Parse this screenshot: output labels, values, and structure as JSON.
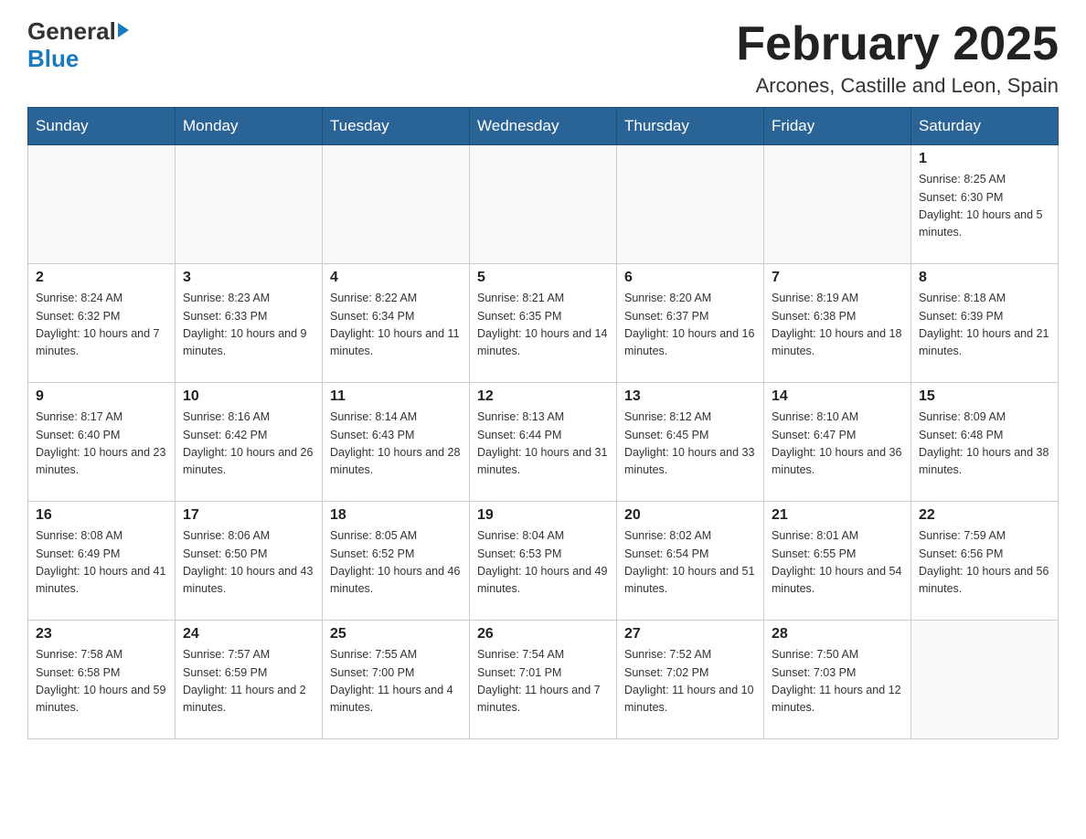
{
  "header": {
    "logo_general": "General",
    "logo_blue": "Blue",
    "month_title": "February 2025",
    "location": "Arcones, Castille and Leon, Spain"
  },
  "weekdays": [
    "Sunday",
    "Monday",
    "Tuesday",
    "Wednesday",
    "Thursday",
    "Friday",
    "Saturday"
  ],
  "weeks": [
    [
      {
        "day": "",
        "sunrise": "",
        "sunset": "",
        "daylight": ""
      },
      {
        "day": "",
        "sunrise": "",
        "sunset": "",
        "daylight": ""
      },
      {
        "day": "",
        "sunrise": "",
        "sunset": "",
        "daylight": ""
      },
      {
        "day": "",
        "sunrise": "",
        "sunset": "",
        "daylight": ""
      },
      {
        "day": "",
        "sunrise": "",
        "sunset": "",
        "daylight": ""
      },
      {
        "day": "",
        "sunrise": "",
        "sunset": "",
        "daylight": ""
      },
      {
        "day": "1",
        "sunrise": "Sunrise: 8:25 AM",
        "sunset": "Sunset: 6:30 PM",
        "daylight": "Daylight: 10 hours and 5 minutes."
      }
    ],
    [
      {
        "day": "2",
        "sunrise": "Sunrise: 8:24 AM",
        "sunset": "Sunset: 6:32 PM",
        "daylight": "Daylight: 10 hours and 7 minutes."
      },
      {
        "day": "3",
        "sunrise": "Sunrise: 8:23 AM",
        "sunset": "Sunset: 6:33 PM",
        "daylight": "Daylight: 10 hours and 9 minutes."
      },
      {
        "day": "4",
        "sunrise": "Sunrise: 8:22 AM",
        "sunset": "Sunset: 6:34 PM",
        "daylight": "Daylight: 10 hours and 11 minutes."
      },
      {
        "day": "5",
        "sunrise": "Sunrise: 8:21 AM",
        "sunset": "Sunset: 6:35 PM",
        "daylight": "Daylight: 10 hours and 14 minutes."
      },
      {
        "day": "6",
        "sunrise": "Sunrise: 8:20 AM",
        "sunset": "Sunset: 6:37 PM",
        "daylight": "Daylight: 10 hours and 16 minutes."
      },
      {
        "day": "7",
        "sunrise": "Sunrise: 8:19 AM",
        "sunset": "Sunset: 6:38 PM",
        "daylight": "Daylight: 10 hours and 18 minutes."
      },
      {
        "day": "8",
        "sunrise": "Sunrise: 8:18 AM",
        "sunset": "Sunset: 6:39 PM",
        "daylight": "Daylight: 10 hours and 21 minutes."
      }
    ],
    [
      {
        "day": "9",
        "sunrise": "Sunrise: 8:17 AM",
        "sunset": "Sunset: 6:40 PM",
        "daylight": "Daylight: 10 hours and 23 minutes."
      },
      {
        "day": "10",
        "sunrise": "Sunrise: 8:16 AM",
        "sunset": "Sunset: 6:42 PM",
        "daylight": "Daylight: 10 hours and 26 minutes."
      },
      {
        "day": "11",
        "sunrise": "Sunrise: 8:14 AM",
        "sunset": "Sunset: 6:43 PM",
        "daylight": "Daylight: 10 hours and 28 minutes."
      },
      {
        "day": "12",
        "sunrise": "Sunrise: 8:13 AM",
        "sunset": "Sunset: 6:44 PM",
        "daylight": "Daylight: 10 hours and 31 minutes."
      },
      {
        "day": "13",
        "sunrise": "Sunrise: 8:12 AM",
        "sunset": "Sunset: 6:45 PM",
        "daylight": "Daylight: 10 hours and 33 minutes."
      },
      {
        "day": "14",
        "sunrise": "Sunrise: 8:10 AM",
        "sunset": "Sunset: 6:47 PM",
        "daylight": "Daylight: 10 hours and 36 minutes."
      },
      {
        "day": "15",
        "sunrise": "Sunrise: 8:09 AM",
        "sunset": "Sunset: 6:48 PM",
        "daylight": "Daylight: 10 hours and 38 minutes."
      }
    ],
    [
      {
        "day": "16",
        "sunrise": "Sunrise: 8:08 AM",
        "sunset": "Sunset: 6:49 PM",
        "daylight": "Daylight: 10 hours and 41 minutes."
      },
      {
        "day": "17",
        "sunrise": "Sunrise: 8:06 AM",
        "sunset": "Sunset: 6:50 PM",
        "daylight": "Daylight: 10 hours and 43 minutes."
      },
      {
        "day": "18",
        "sunrise": "Sunrise: 8:05 AM",
        "sunset": "Sunset: 6:52 PM",
        "daylight": "Daylight: 10 hours and 46 minutes."
      },
      {
        "day": "19",
        "sunrise": "Sunrise: 8:04 AM",
        "sunset": "Sunset: 6:53 PM",
        "daylight": "Daylight: 10 hours and 49 minutes."
      },
      {
        "day": "20",
        "sunrise": "Sunrise: 8:02 AM",
        "sunset": "Sunset: 6:54 PM",
        "daylight": "Daylight: 10 hours and 51 minutes."
      },
      {
        "day": "21",
        "sunrise": "Sunrise: 8:01 AM",
        "sunset": "Sunset: 6:55 PM",
        "daylight": "Daylight: 10 hours and 54 minutes."
      },
      {
        "day": "22",
        "sunrise": "Sunrise: 7:59 AM",
        "sunset": "Sunset: 6:56 PM",
        "daylight": "Daylight: 10 hours and 56 minutes."
      }
    ],
    [
      {
        "day": "23",
        "sunrise": "Sunrise: 7:58 AM",
        "sunset": "Sunset: 6:58 PM",
        "daylight": "Daylight: 10 hours and 59 minutes."
      },
      {
        "day": "24",
        "sunrise": "Sunrise: 7:57 AM",
        "sunset": "Sunset: 6:59 PM",
        "daylight": "Daylight: 11 hours and 2 minutes."
      },
      {
        "day": "25",
        "sunrise": "Sunrise: 7:55 AM",
        "sunset": "Sunset: 7:00 PM",
        "daylight": "Daylight: 11 hours and 4 minutes."
      },
      {
        "day": "26",
        "sunrise": "Sunrise: 7:54 AM",
        "sunset": "Sunset: 7:01 PM",
        "daylight": "Daylight: 11 hours and 7 minutes."
      },
      {
        "day": "27",
        "sunrise": "Sunrise: 7:52 AM",
        "sunset": "Sunset: 7:02 PM",
        "daylight": "Daylight: 11 hours and 10 minutes."
      },
      {
        "day": "28",
        "sunrise": "Sunrise: 7:50 AM",
        "sunset": "Sunset: 7:03 PM",
        "daylight": "Daylight: 11 hours and 12 minutes."
      },
      {
        "day": "",
        "sunrise": "",
        "sunset": "",
        "daylight": ""
      }
    ]
  ]
}
